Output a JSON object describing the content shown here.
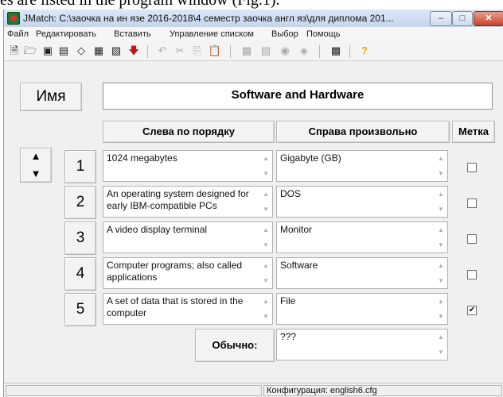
{
  "background_text": "es are listed in the program window (Fig.1).",
  "window": {
    "title": "JMatch: C:\\заочка на ин язе 2016-2018\\4 семестр заочка англ яз\\для диплома 201...",
    "minimize": "–",
    "maximize": "□",
    "close": "✕"
  },
  "menu": [
    "Файл",
    "Редактировать",
    "Вставить",
    "Управление списком",
    "Выбор",
    "Помощь"
  ],
  "toolbar": {
    "icons": [
      "new-file-icon",
      "open-folder-icon",
      "save-icon",
      "save-as-icon",
      "eraser-icon",
      "export-html-icon",
      "export-alt-icon",
      "down-arrow-icon",
      "undo-icon",
      "cut-icon",
      "copy-icon",
      "paste-icon",
      "add-icon",
      "shuffle-icon",
      "settings-icon",
      "config-icon",
      "palette-icon",
      "help-icon"
    ],
    "help_label": "?"
  },
  "name_button": "Имя",
  "exercise_title": "Software and Hardware",
  "headers": {
    "left": "Слева по порядку",
    "right": "Справа произвольно",
    "mark": "Метка"
  },
  "rows": [
    {
      "num": "1",
      "left": "1024 megabytes",
      "right": "Gigabyte (GB)",
      "checked": false
    },
    {
      "num": "2",
      "left": "An operating system designed for early IBM-compatible PCs",
      "right": "DOS",
      "checked": false
    },
    {
      "num": "3",
      "left": "A video display terminal",
      "right": "Monitor",
      "checked": false
    },
    {
      "num": "4",
      "left": "Computer programs; also called applications",
      "right": "Software",
      "checked": false
    },
    {
      "num": "5",
      "left": "A set of data that is stored in the computer",
      "right": "File",
      "checked": true
    }
  ],
  "default": {
    "label": "Обычно:",
    "value": "???"
  },
  "status": {
    "config": "Конфигурация: english6.cfg"
  },
  "glyphs": {
    "check": "✔",
    "up": "▲",
    "down": "▼"
  }
}
